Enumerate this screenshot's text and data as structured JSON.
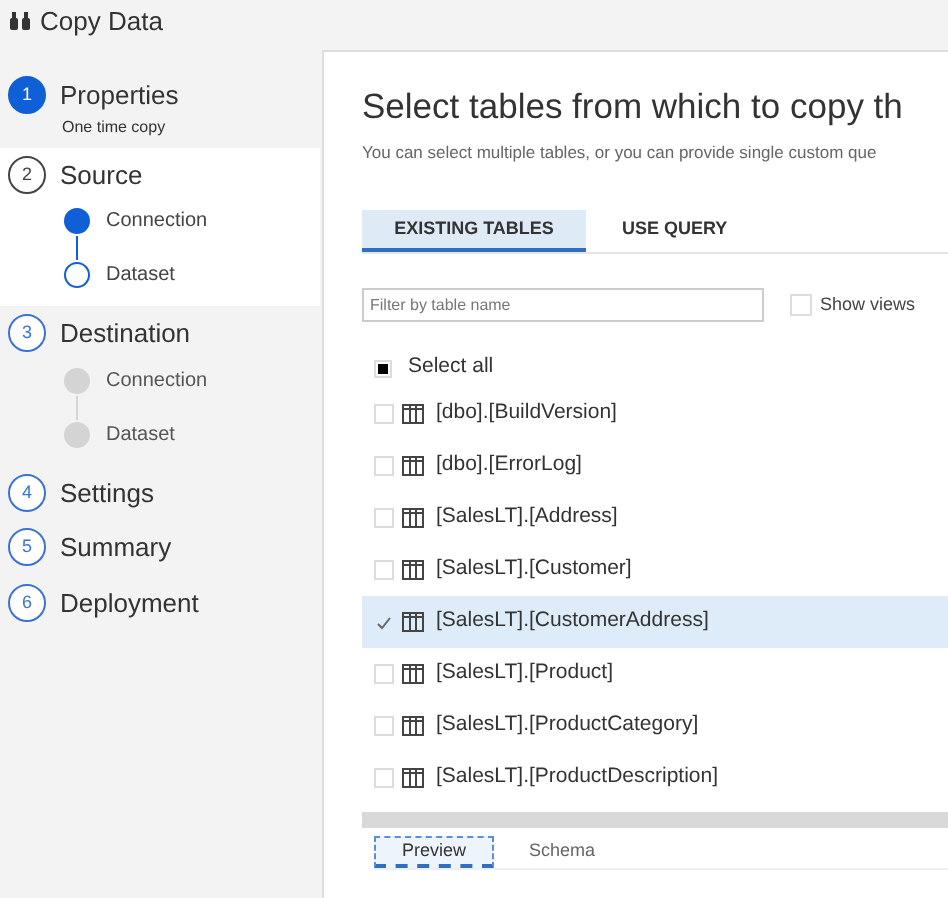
{
  "window": {
    "title": "Copy Data"
  },
  "steps": [
    {
      "number": "1",
      "label": "Properties",
      "subtitle": "One time copy",
      "completed": true,
      "selected": false
    },
    {
      "number": "2",
      "label": "Source",
      "completed": false,
      "selected": true,
      "substeps": [
        {
          "label": "Connection",
          "completed": true,
          "disabled": false
        },
        {
          "label": "Dataset",
          "completed": false,
          "disabled": false
        }
      ]
    },
    {
      "number": "3",
      "label": "Destination",
      "completed": false,
      "selected": false,
      "substeps": [
        {
          "label": "Connection",
          "disabled": true
        },
        {
          "label": "Dataset",
          "disabled": true
        }
      ]
    },
    {
      "number": "4",
      "label": "Settings",
      "completed": false,
      "selected": false
    },
    {
      "number": "5",
      "label": "Summary",
      "completed": false,
      "selected": false
    },
    {
      "number": "6",
      "label": "Deployment",
      "completed": false,
      "selected": false
    }
  ],
  "main": {
    "heading": "Select tables from which to copy th",
    "description": "You can select multiple tables, or you can provide single custom que",
    "tabs": [
      {
        "label": "EXISTING TABLES",
        "selected": true
      },
      {
        "label": "USE QUERY",
        "selected": false
      }
    ],
    "filter": {
      "placeholder": "Filter by table name"
    },
    "show_views": {
      "label": "Show views",
      "checked": false
    },
    "select_all": {
      "label": "Select all",
      "indeterminate": true
    },
    "tables": [
      {
        "name": "[dbo].[BuildVersion]",
        "checked": false
      },
      {
        "name": "[dbo].[ErrorLog]",
        "checked": false
      },
      {
        "name": "[SalesLT].[Address]",
        "checked": false
      },
      {
        "name": "[SalesLT].[Customer]",
        "checked": false
      },
      {
        "name": "[SalesLT].[CustomerAddress]",
        "checked": true
      },
      {
        "name": "[SalesLT].[Product]",
        "checked": false
      },
      {
        "name": "[SalesLT].[ProductCategory]",
        "checked": false
      },
      {
        "name": "[SalesLT].[ProductDescription]",
        "checked": false
      }
    ],
    "bottom_tabs": [
      {
        "label": "Preview",
        "selected": true
      },
      {
        "label": "Schema",
        "selected": false
      }
    ]
  }
}
